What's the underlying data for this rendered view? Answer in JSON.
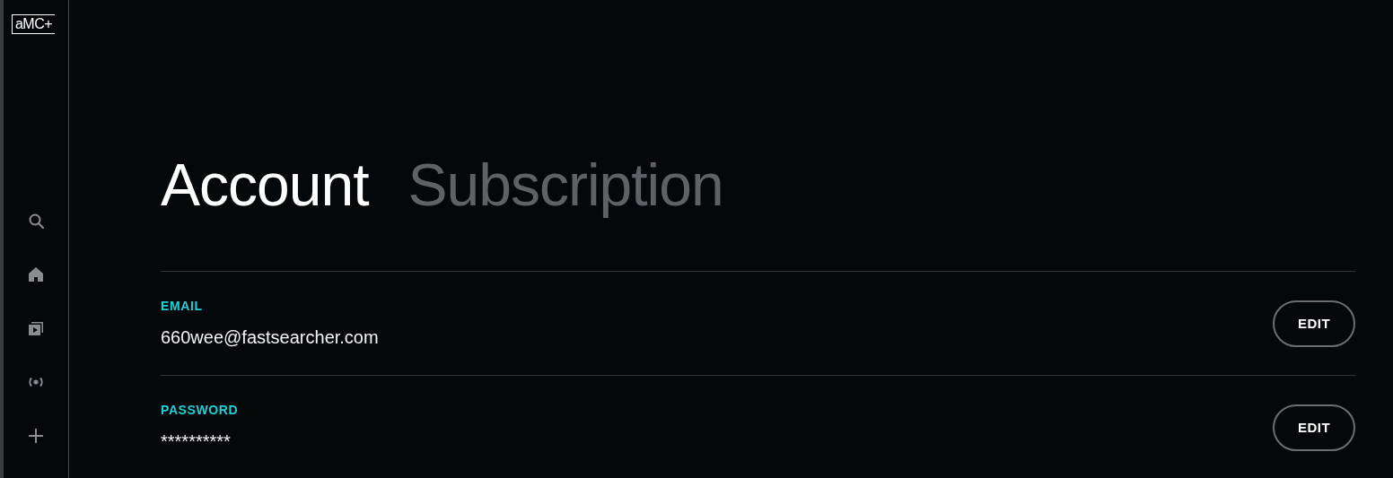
{
  "logo": "aMC+",
  "nav": [
    {
      "kind": "search"
    },
    {
      "kind": "home"
    },
    {
      "kind": "library"
    },
    {
      "kind": "live"
    },
    {
      "kind": "add"
    }
  ],
  "tabs": [
    {
      "label": "Account",
      "selected": true
    },
    {
      "label": "Subscription",
      "selected": false
    }
  ],
  "fields": [
    {
      "label": "EMAIL",
      "value": "660wee@fastsearcher.com",
      "button": "EDIT"
    },
    {
      "label": "PASSWORD",
      "value": "**********",
      "button": "EDIT"
    }
  ]
}
